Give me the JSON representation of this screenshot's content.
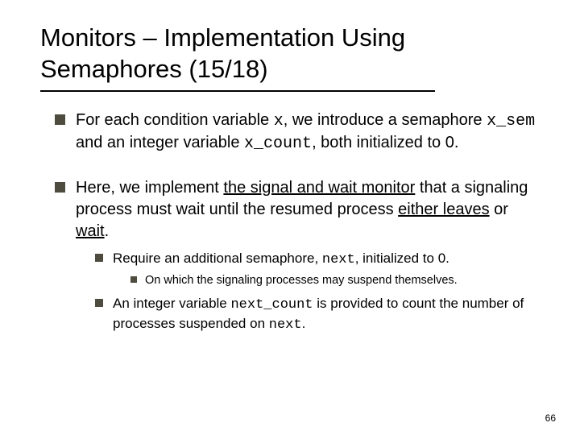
{
  "title": "Monitors – Implementation Using Semaphores (15/18)",
  "bullets": [
    {
      "pre1": "For each condition variable ",
      "code1": "x",
      "mid1": ", we introduce a semaphore ",
      "code2": "x_sem",
      "mid2": " and an integer variable ",
      "code3": "x_count",
      "post": ", both initialized to 0."
    },
    {
      "pre1": "Here, we implement ",
      "ul1": "the signal and wait monitor",
      "mid1": " that a signaling process must wait until the resumed process ",
      "ul2": "either leaves",
      "mid2": " or ",
      "ul3": "wait",
      "post": ".",
      "sub": [
        {
          "pre": "Require an additional semaphore, ",
          "code": "next",
          "post": ", initialized to 0.",
          "sub": [
            {
              "text": "On which the signaling processes may suspend themselves."
            }
          ]
        },
        {
          "pre": "An integer variable ",
          "code": "next_count",
          "mid": " is provided to count the number of processes suspended on ",
          "code2": "next",
          "post": "."
        }
      ]
    }
  ],
  "pageNumber": "66"
}
